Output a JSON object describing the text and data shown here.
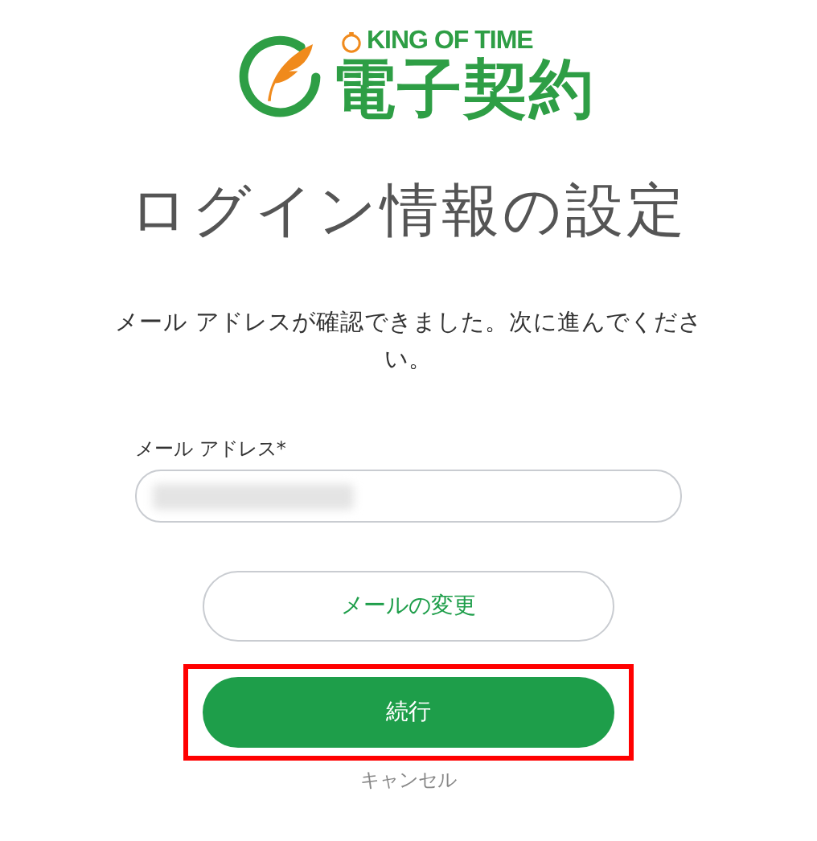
{
  "logo": {
    "brand": "KING OF TIME",
    "product": "電子契約"
  },
  "title": "ログイン情報の設定",
  "message": "メール アドレスが確認できました。次に進んでください。",
  "email_field": {
    "label": "メール アドレス*",
    "redacted": true
  },
  "buttons": [
    {
      "label": "メールの変更",
      "kind": "outline",
      "highlighted": false
    },
    {
      "label": "続行",
      "kind": "primary",
      "highlighted": true
    }
  ],
  "cancel_link": "キャンセル"
}
